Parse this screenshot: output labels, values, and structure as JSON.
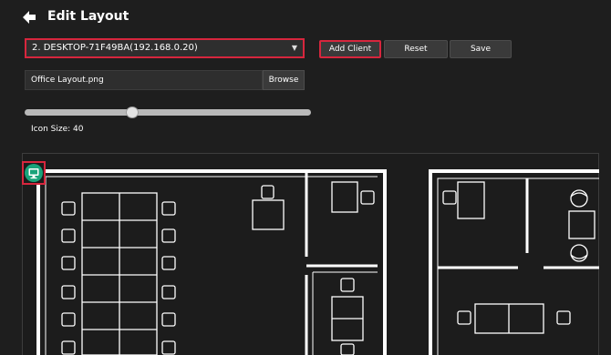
{
  "header": {
    "title": "Edit Layout",
    "back_icon": "arrow-left-icon"
  },
  "client_select": {
    "value": "2. DESKTOP-71F49BA(192.168.0.20)",
    "caret_icon": "caret-down-icon"
  },
  "toolbar": {
    "add_client_label": "Add Client",
    "reset_label": "Reset",
    "save_label": "Save"
  },
  "file": {
    "value": "Office Layout.png",
    "browse_label": "Browse"
  },
  "icon_size": {
    "label": "Icon Size: 40",
    "value": 40
  },
  "colors": {
    "background": "#1e1e1e",
    "highlight": "#d7263d",
    "client_icon": "#1aa37a",
    "plan_lines": "#ffffff"
  },
  "placed_clients": [
    {
      "icon": "monitor-client-icon"
    }
  ]
}
